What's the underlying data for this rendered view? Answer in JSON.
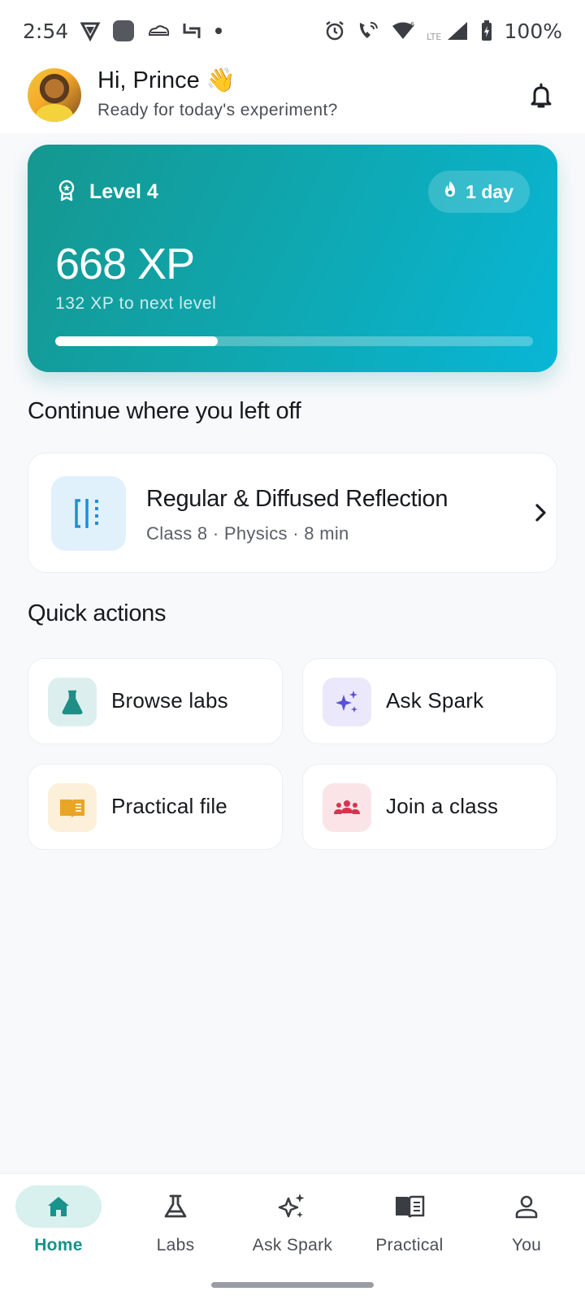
{
  "status_bar": {
    "time": "2:54",
    "battery": "100%",
    "network": "LTE",
    "icons_left": [
      "vpn-icon",
      "app-icon",
      "cloud-icon",
      "screenshot-icon",
      "dot-icon"
    ],
    "icons_right": [
      "alarm-icon",
      "wifi-calling-icon",
      "wifi-icon",
      "signal-icon",
      "battery-icon"
    ]
  },
  "header": {
    "greeting": "Hi, Prince 👋",
    "subtitle": "Ready for today's experiment?",
    "bell_icon": "bell-icon"
  },
  "xp_card": {
    "level": "Level 4",
    "streak": "1 day",
    "xp": "668 XP",
    "next_level": "132 XP to next level",
    "progress_fraction": 0.34,
    "colors": {
      "start": "#15978f",
      "end": "#08b6d6"
    }
  },
  "continue": {
    "title": "Continue where you left off",
    "lesson": {
      "title": "Regular & Diffused Reflection",
      "meta": "Class 8 · Physics · 8 min",
      "icon": "reflection-icon"
    }
  },
  "quick_actions": {
    "title": "Quick actions",
    "items": [
      {
        "label": "Browse labs",
        "icon": "flask-icon",
        "bg": "#dcefee",
        "color": "#1f8f86"
      },
      {
        "label": "Ask Spark",
        "icon": "sparkle-icon",
        "bg": "#ebe8fb",
        "color": "#5b4fd6"
      },
      {
        "label": "Practical file",
        "icon": "book-icon",
        "bg": "#fdf0da",
        "color": "#e8a526"
      },
      {
        "label": "Join a class",
        "icon": "group-icon",
        "bg": "#fbe4e8",
        "color": "#d8344f"
      }
    ]
  },
  "bottom_nav": {
    "active": "Home",
    "items": [
      {
        "label": "Home",
        "icon": "home-icon"
      },
      {
        "label": "Labs",
        "icon": "flask-icon"
      },
      {
        "label": "Ask Spark",
        "icon": "sparkle-icon"
      },
      {
        "label": "Practical",
        "icon": "book-icon"
      },
      {
        "label": "You",
        "icon": "person-icon"
      }
    ],
    "accent": "#16938a"
  }
}
